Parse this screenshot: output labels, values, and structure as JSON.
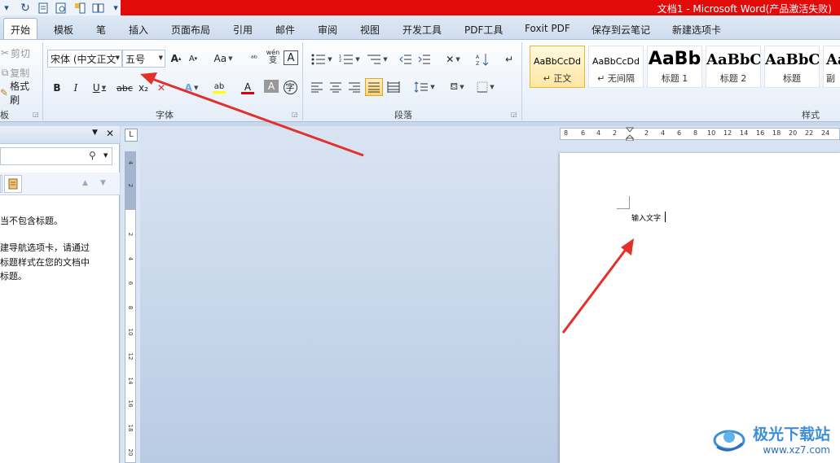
{
  "window": {
    "title": "文档1 - Microsoft Word(产品激活失败)"
  },
  "tabs": [
    {
      "label": "开始",
      "active": true
    },
    {
      "label": "模板"
    },
    {
      "label": "笔"
    },
    {
      "label": "插入"
    },
    {
      "label": "页面布局"
    },
    {
      "label": "引用"
    },
    {
      "label": "邮件"
    },
    {
      "label": "审阅"
    },
    {
      "label": "视图"
    },
    {
      "label": "开发工具"
    },
    {
      "label": "PDF工具"
    },
    {
      "label": "Foxit PDF"
    },
    {
      "label": "保存到云笔记"
    },
    {
      "label": "新建选项卡"
    }
  ],
  "clipboard": {
    "cut": "剪切",
    "copy": "复制",
    "format_painter": "格式刷",
    "group_label": "板"
  },
  "font": {
    "font_name": "宋体 (中文正文",
    "font_size": "五号",
    "group_label": "字体",
    "aa_label": "Aa",
    "wen_label": "wén",
    "wen_char": "文",
    "biantext": "变",
    "A_char": "A",
    "zi_char": "字",
    "bold": "B",
    "italic": "I",
    "underline": "U",
    "strike": "abc",
    "sub": "x₂",
    "clear": "✕",
    "highlight": "ab"
  },
  "paragraph": {
    "group_label": "段落"
  },
  "styles": {
    "group_label": "样式",
    "items": [
      {
        "preview": "AaBbCcDd",
        "name": "↵ 正文",
        "selected": true
      },
      {
        "preview": "AaBbCcDd",
        "name": "↵ 无间隔"
      },
      {
        "preview": "AaBb",
        "name": "标题 1"
      },
      {
        "preview": "AaBbC",
        "name": "标题 2"
      },
      {
        "preview": "AaBbC",
        "name": "标题"
      },
      {
        "preview": "Aa",
        "name": "副"
      }
    ]
  },
  "nav_pane": {
    "search_icon": "search-icon",
    "lines": [
      "当不包含标题。",
      "建导航选项卡，请通过",
      "标题样式在您的文档中",
      "标题。"
    ]
  },
  "ruler": {
    "corner": "L",
    "h_numbers": [
      "8",
      "6",
      "4",
      "2",
      "2",
      "4",
      "6",
      "8",
      "10",
      "12",
      "14",
      "16",
      "18",
      "20",
      "22",
      "24"
    ],
    "v_numbers": [
      "4",
      "2",
      "2",
      "4",
      "6",
      "8",
      "10",
      "12",
      "14",
      "16",
      "18",
      "20"
    ]
  },
  "document": {
    "text": "输入文字"
  },
  "watermark": {
    "name": "极光下载站",
    "url": "www.xz7.com"
  },
  "colors": {
    "title_red": "#e30a0a",
    "ribbon_blue": "#dfe9f6",
    "arrow_red": "#e3302a",
    "font_color_red": "#e00000"
  }
}
